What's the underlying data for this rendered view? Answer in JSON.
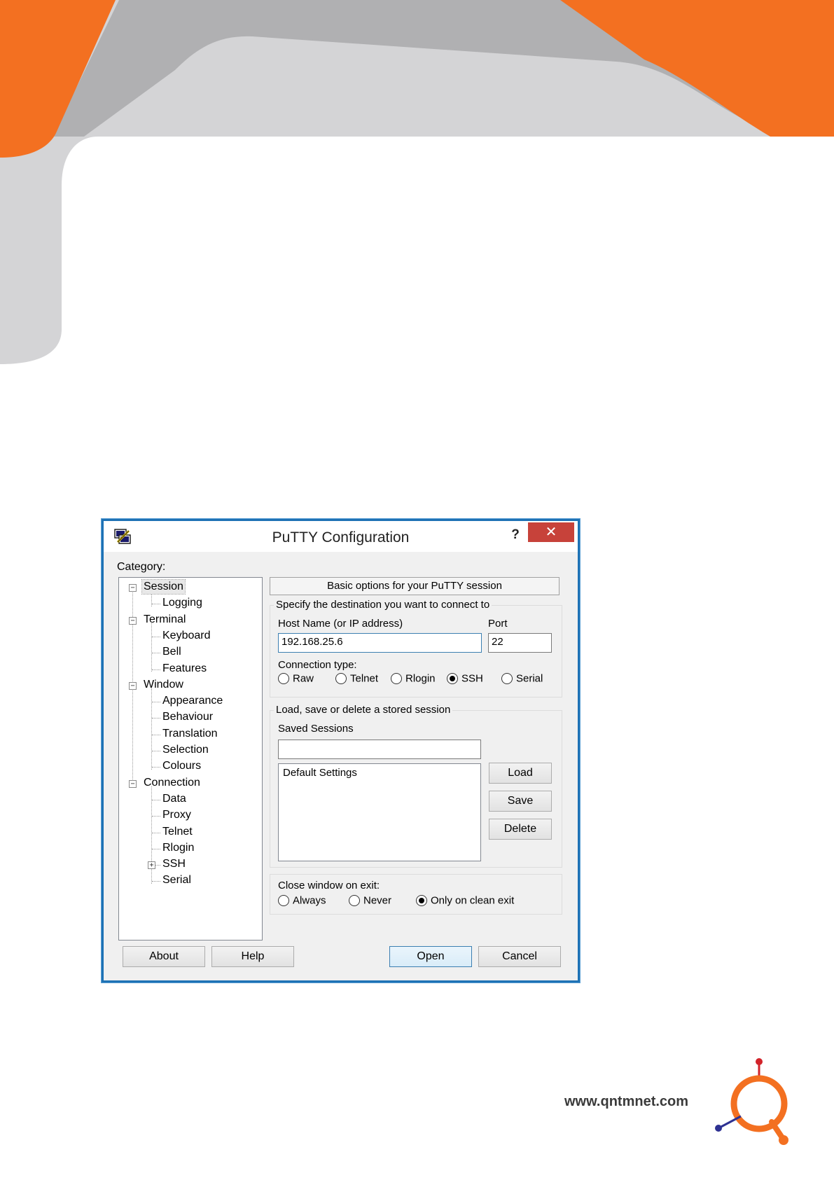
{
  "dialog": {
    "title": "PuTTY Configuration",
    "help_label": "?",
    "close_label": "✕",
    "category_label": "Category:",
    "tree": [
      {
        "label": "Session",
        "level": 0,
        "expander": "minus",
        "selected": true
      },
      {
        "label": "Logging",
        "level": 1
      },
      {
        "label": "Terminal",
        "level": 0,
        "expander": "minus"
      },
      {
        "label": "Keyboard",
        "level": 1
      },
      {
        "label": "Bell",
        "level": 1
      },
      {
        "label": "Features",
        "level": 1
      },
      {
        "label": "Window",
        "level": 0,
        "expander": "minus"
      },
      {
        "label": "Appearance",
        "level": 1
      },
      {
        "label": "Behaviour",
        "level": 1
      },
      {
        "label": "Translation",
        "level": 1
      },
      {
        "label": "Selection",
        "level": 1
      },
      {
        "label": "Colours",
        "level": 1
      },
      {
        "label": "Connection",
        "level": 0,
        "expander": "minus"
      },
      {
        "label": "Data",
        "level": 1
      },
      {
        "label": "Proxy",
        "level": 1
      },
      {
        "label": "Telnet",
        "level": 1
      },
      {
        "label": "Rlogin",
        "level": 1
      },
      {
        "label": "SSH",
        "level": 1,
        "expander": "plus"
      },
      {
        "label": "Serial",
        "level": 1
      }
    ],
    "panel_header": "Basic options for your PuTTY session",
    "destination": {
      "title": "Specify the destination you want to connect to",
      "host_label": "Host Name (or IP address)",
      "host_value": "192.168.25.6",
      "port_label": "Port",
      "port_value": "22",
      "conn_type_label": "Connection type:",
      "conn_types": [
        {
          "label": "Raw",
          "checked": false
        },
        {
          "label": "Telnet",
          "checked": false
        },
        {
          "label": "Rlogin",
          "checked": false
        },
        {
          "label": "SSH",
          "checked": true
        },
        {
          "label": "Serial",
          "checked": false
        }
      ]
    },
    "sessions": {
      "title": "Load, save or delete a stored session",
      "saved_label": "Saved Sessions",
      "saved_value": "",
      "items": [
        "Default Settings"
      ],
      "load_label": "Load",
      "save_label": "Save",
      "delete_label": "Delete"
    },
    "close_on_exit": {
      "label": "Close window on exit:",
      "options": [
        {
          "label": "Always",
          "checked": false
        },
        {
          "label": "Never",
          "checked": false
        },
        {
          "label": "Only on clean exit",
          "checked": true
        }
      ]
    },
    "buttons": {
      "about": "About",
      "help": "Help",
      "open": "Open",
      "cancel": "Cancel"
    }
  },
  "footer": {
    "url": "www.qntmnet.com"
  },
  "colors": {
    "brand_orange": "#f37021",
    "brand_grey": "#b0b0b2",
    "titlebar_close": "#c7423a",
    "window_border": "#1e72b5"
  }
}
